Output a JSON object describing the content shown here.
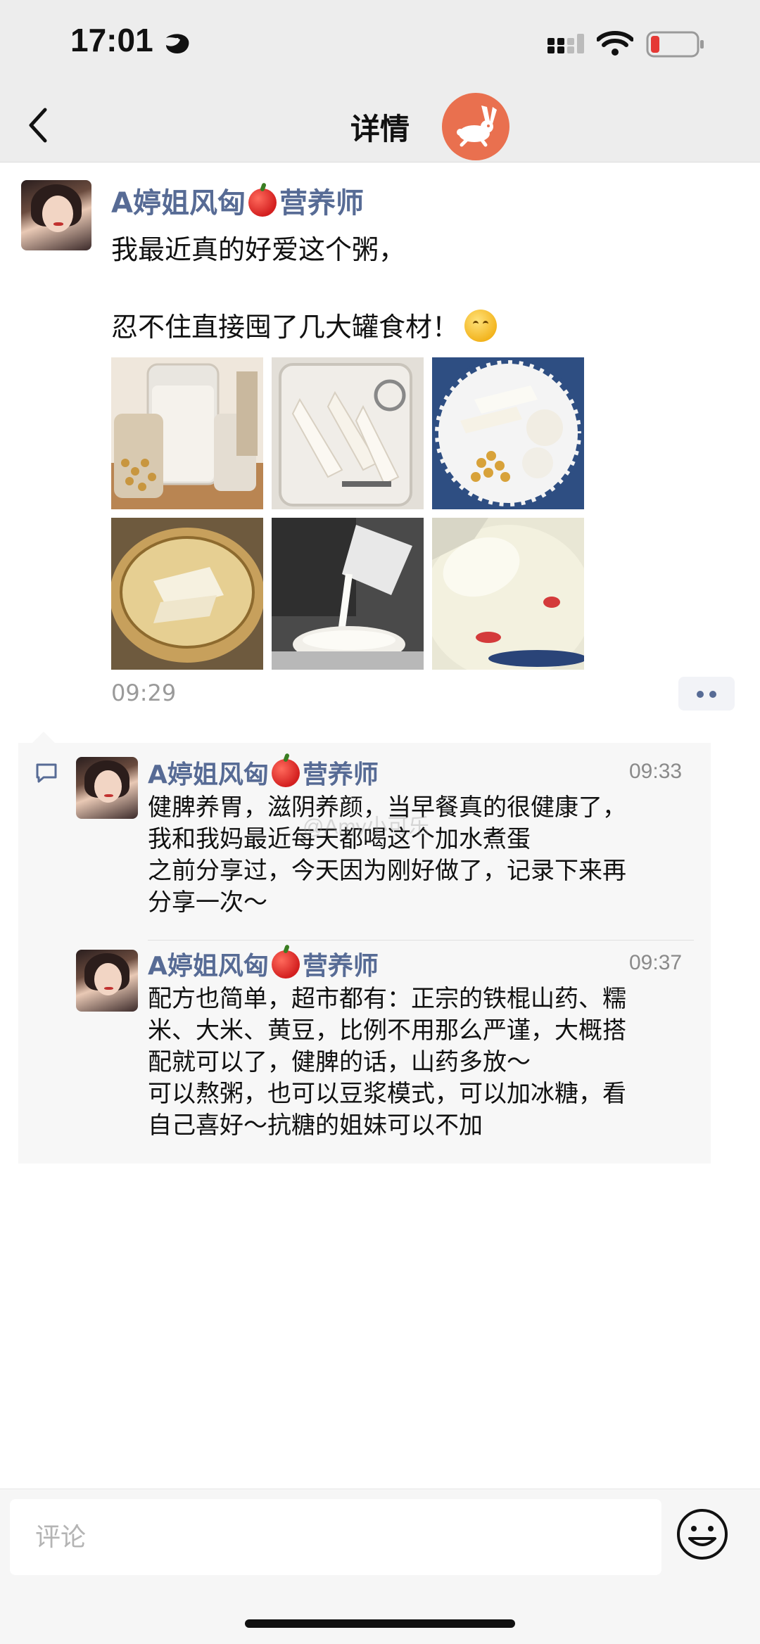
{
  "status_bar": {
    "time": "17:01",
    "icons": [
      "moon-icon",
      "signal-icon",
      "wifi-icon",
      "battery-icon"
    ],
    "battery_color": "#e53935"
  },
  "nav": {
    "title": "详情",
    "back_icon": "chevron-left-icon",
    "badge_icon": "rabbit-icon",
    "badge_color": "#e9704f"
  },
  "post": {
    "author": "A婷姐风匈",
    "author_suffix": "营养师",
    "text_line1": "我最近真的好爱这个粥，",
    "text_line2": "忍不住直接囤了几大罐食材！",
    "time": "09:29",
    "photos": [
      "jars-of-grains-photo",
      "jar-of-yam-slices-photo",
      "ingredients-plate-photo",
      "soaking-yam-bowl-photo",
      "pouring-soymilk-photo",
      "porridge-spoon-photo"
    ]
  },
  "comments": [
    {
      "author": "A婷姐风匈",
      "author_suffix": "营养师",
      "time": "09:33",
      "lines": [
        "健脾养胃，滋阴养颜，当早餐真的很健康了，",
        "我和我妈最近每天都喝这个加水煮蛋",
        "之前分享过，今天因为刚好做了，记录下来再",
        "分享一次～"
      ]
    },
    {
      "author": "A婷姐风匈",
      "author_suffix": "营养师",
      "time": "09:37",
      "lines": [
        "配方也简单，超市都有：正宗的铁棍山药、糯",
        "米、大米、黄豆，比例不用那么严谨，大概搭",
        "配就可以了，健脾的话，山药多放～",
        "可以熬粥，也可以豆浆模式，可以加冰糖，看",
        "自己喜好～抗糖的姐妹可以不加"
      ]
    }
  ],
  "watermark": "@Amy小可乐",
  "input": {
    "placeholder": "评论"
  },
  "colors": {
    "link_name": "#576b95",
    "background": "#ededed"
  }
}
